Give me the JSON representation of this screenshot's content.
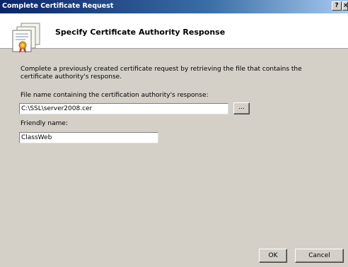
{
  "window": {
    "title": "Complete Certificate Request",
    "help_label": "?",
    "close_label": "×"
  },
  "header": {
    "title": "Specify Certificate Authority Response",
    "icon": "certificate-icon"
  },
  "body": {
    "description": "Complete a previously created certificate request by retrieving the file that contains the certificate authority's response.",
    "file_label": "File name containing the certification authority's response:",
    "file_value": "C:\\SSL\\server2008.cer",
    "browse_label": "...",
    "friendly_label": "Friendly name:",
    "friendly_value": "ClassWeb"
  },
  "footer": {
    "ok_label": "OK",
    "cancel_label": "Cancel"
  },
  "colors": {
    "titlebar_start": "#0a246a",
    "titlebar_end": "#a6caf0",
    "dialog_bg": "#d4d0c8",
    "header_bg": "#ffffff"
  }
}
